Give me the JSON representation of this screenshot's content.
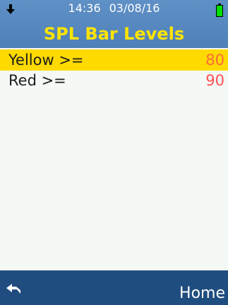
{
  "header": {
    "time": "14:36",
    "date": "03/08/16",
    "title": "SPL Bar Levels",
    "icons": [
      "download-arrow-icon",
      "battery-icon"
    ],
    "title_color": "#ffe400",
    "battery_color": "#00e000"
  },
  "list": {
    "items": [
      {
        "label": "Yellow >=",
        "value": "80",
        "value_color": "#ff6a3a",
        "selected": true
      },
      {
        "label": "Red >=",
        "value": "90",
        "value_color": "#ff5050",
        "selected": false
      }
    ],
    "selected_color": "#ffda00"
  },
  "footer": {
    "back_icon": "back-arrow-icon",
    "home_label": "Home"
  }
}
